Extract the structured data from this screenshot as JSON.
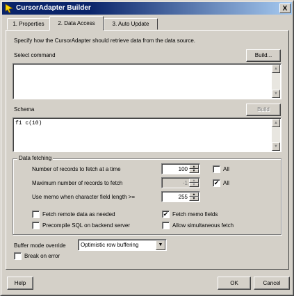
{
  "window": {
    "title": "CursorAdapter Builder",
    "close_label": "X"
  },
  "tabs": [
    {
      "label": "1. Properties",
      "active": false
    },
    {
      "label": "2. Data Access",
      "active": true
    },
    {
      "label": "3. Auto Update",
      "active": false
    }
  ],
  "data_access": {
    "description": "Specify how the CursorAdapter should retrieve data from the data source.",
    "select_command": {
      "label": "Select command",
      "value": "",
      "build_label": "Build..."
    },
    "schema": {
      "label": "Schema",
      "value": "f1 c(10)",
      "build_label": "Build"
    },
    "data_fetching": {
      "legend": "Data fetching",
      "records_to_fetch": {
        "label": "Number of records to fetch at a time",
        "value": "100",
        "all_label": "All",
        "all_checked": false
      },
      "max_records": {
        "label": "Maximum number of records to fetch",
        "value": "-1",
        "all_label": "All",
        "all_checked": true
      },
      "use_memo": {
        "label": "Use memo when character field length >=",
        "value": "255"
      },
      "fetch_remote": {
        "label": "Fetch remote data as needed",
        "checked": false
      },
      "fetch_memo": {
        "label": "Fetch memo fields",
        "checked": true
      },
      "precompile": {
        "label": "Precompile SQL on backend server",
        "checked": false
      },
      "allow_simultaneous": {
        "label": "Allow simultaneous fetch",
        "checked": false
      }
    },
    "buffer_mode": {
      "label": "Buffer mode override",
      "selected": "Optimistic row buffering"
    },
    "break_on_error": {
      "label": "Break on error",
      "checked": false
    }
  },
  "footer": {
    "help_label": "Help",
    "ok_label": "OK",
    "cancel_label": "Cancel"
  },
  "icons": {
    "app": "cursor-adapter-icon",
    "check": "✔"
  }
}
